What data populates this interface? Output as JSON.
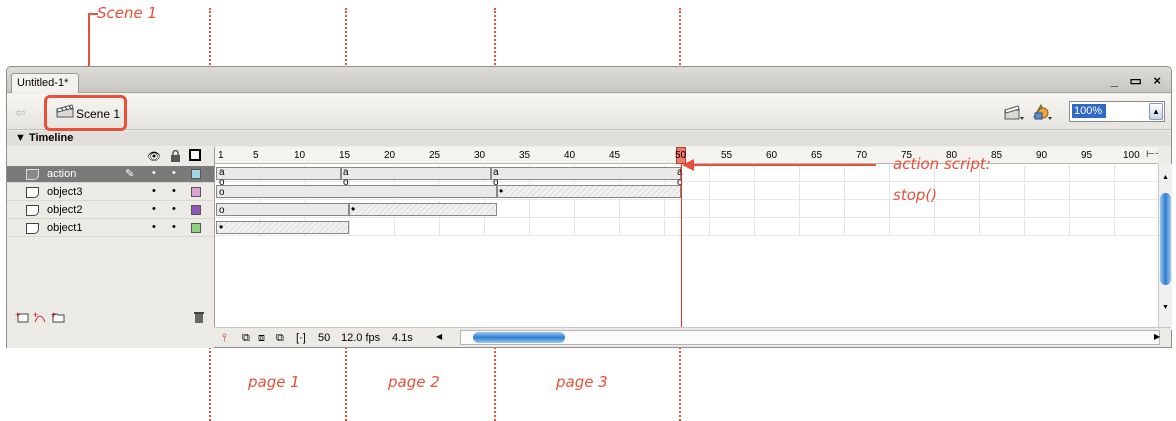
{
  "annotations": {
    "scene_callout": "Scene 1",
    "action_note_line1": "action script:",
    "action_note_line2": "stop()",
    "page1": "page 1",
    "page2": "page 2",
    "page3": "page 3"
  },
  "window": {
    "tab_title": "Untitled-1*",
    "window_controls": "_ ▭ ×",
    "scene_label": "Scene 1",
    "zoom_value": "100%"
  },
  "timeline": {
    "header": "▼ Timeline",
    "ruler_ticks": [
      "1",
      "5",
      "10",
      "15",
      "20",
      "25",
      "30",
      "35",
      "40",
      "45",
      "50",
      "55",
      "60",
      "65",
      "70",
      "75",
      "80",
      "85",
      "90",
      "95",
      "100"
    ],
    "layers": [
      {
        "name": "action",
        "color": "#9fd6e6",
        "selected": true
      },
      {
        "name": "object3",
        "color": "#dba2d5",
        "selected": false
      },
      {
        "name": "object2",
        "color": "#8e5ab8",
        "selected": false
      },
      {
        "name": "object1",
        "color": "#8cd27e",
        "selected": false
      }
    ],
    "status": {
      "current_frame": "50",
      "fps": "12.0 fps",
      "time": "4.1s"
    }
  },
  "colors": {
    "annotation": "#e8503a"
  }
}
